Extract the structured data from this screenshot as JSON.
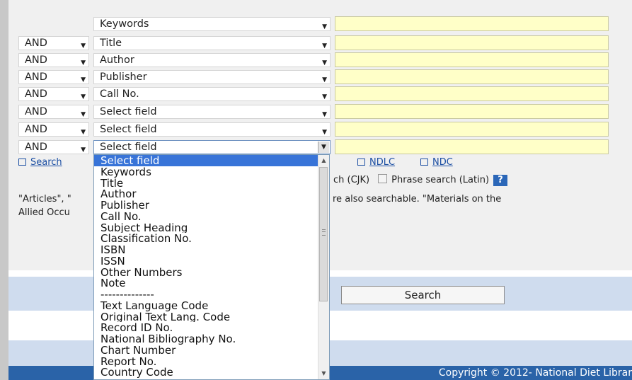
{
  "colors": {
    "panel_bg": "#f0f0f0",
    "input_bg": "#ffffc8",
    "band_bg": "#cfdcee",
    "footer_bg": "#2a63a8",
    "selected_option_bg": "#3874d8",
    "link_color": "#1c4fa3"
  },
  "rows": [
    {
      "operator": "",
      "field": "Keywords"
    },
    {
      "operator": "AND",
      "field": "Title"
    },
    {
      "operator": "AND",
      "field": "Author"
    },
    {
      "operator": "AND",
      "field": "Publisher"
    },
    {
      "operator": "AND",
      "field": "Call No."
    },
    {
      "operator": "AND",
      "field": "Select field"
    },
    {
      "operator": "AND",
      "field": "Select field"
    },
    {
      "operator": "AND",
      "field": "Select field"
    }
  ],
  "links": {
    "search": "Search",
    "ndlc": "NDLC",
    "ndc": "NDC"
  },
  "options_row": {
    "cjk_partial": "ch (CJK)",
    "phrase_latin": "Phrase search (Latin)",
    "help": "?"
  },
  "notes": {
    "line1_left": "\"Articles\", \"",
    "line1_right": "re also searchable. \"Materials on the",
    "line2_left": "Allied Occu"
  },
  "search_button": "Search",
  "footer": "Copyright © 2012- National Diet Librar",
  "dropdown": {
    "selected": "Select field",
    "options": [
      "Select field",
      "Keywords",
      "Title",
      "Author",
      "Publisher",
      "Call No.",
      "Subject Heading",
      "Classification No.",
      "ISBN",
      "ISSN",
      "Other Numbers",
      "Note",
      "--------------",
      "Text Language Code",
      "Original Text Lang. Code",
      "Record ID No.",
      "National Bibliography No.",
      "Chart Number",
      "Report No.",
      "Country Code"
    ]
  }
}
